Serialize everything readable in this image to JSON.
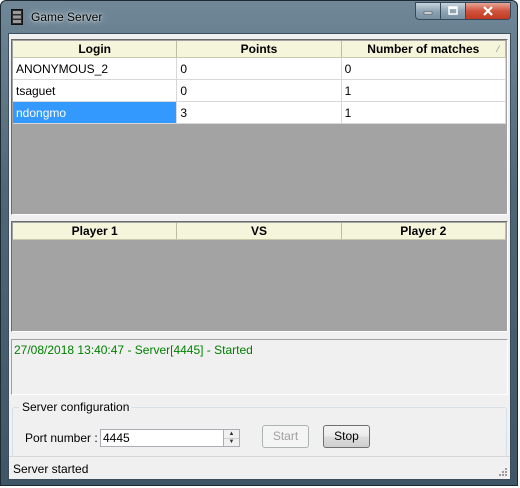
{
  "window": {
    "title": "Game Server",
    "icon": "app-icon",
    "caption_buttons": [
      "minimize-icon",
      "maximize-icon",
      "close-icon"
    ]
  },
  "players_table": {
    "columns": [
      "Login",
      "Points",
      "Number of matches"
    ],
    "rows": [
      {
        "login": "ANONYMOUS_2",
        "points": "0",
        "matches": "0",
        "selected": false
      },
      {
        "login": "tsaguet",
        "points": "0",
        "matches": "1",
        "selected": false
      },
      {
        "login": "ndongmo",
        "points": "3",
        "matches": "1",
        "selected": true
      }
    ]
  },
  "matches_table": {
    "columns": [
      "Player 1",
      "VS",
      "Player 2"
    ],
    "rows": []
  },
  "log": {
    "lines": [
      "27/08/2018 13:40:47 - Server[4445] - Started"
    ],
    "color": "#008000"
  },
  "server_config": {
    "group_title": "Server configuration",
    "port_label": "Port number :",
    "port_value": "4445",
    "start_label": "Start",
    "start_enabled": false,
    "stop_label": "Stop",
    "stop_enabled": true
  },
  "status": {
    "text": "Server started"
  },
  "colors": {
    "header_bg": "#f5f5dc",
    "selection": "#3399ff",
    "grid_empty": "#a3a3a3"
  }
}
